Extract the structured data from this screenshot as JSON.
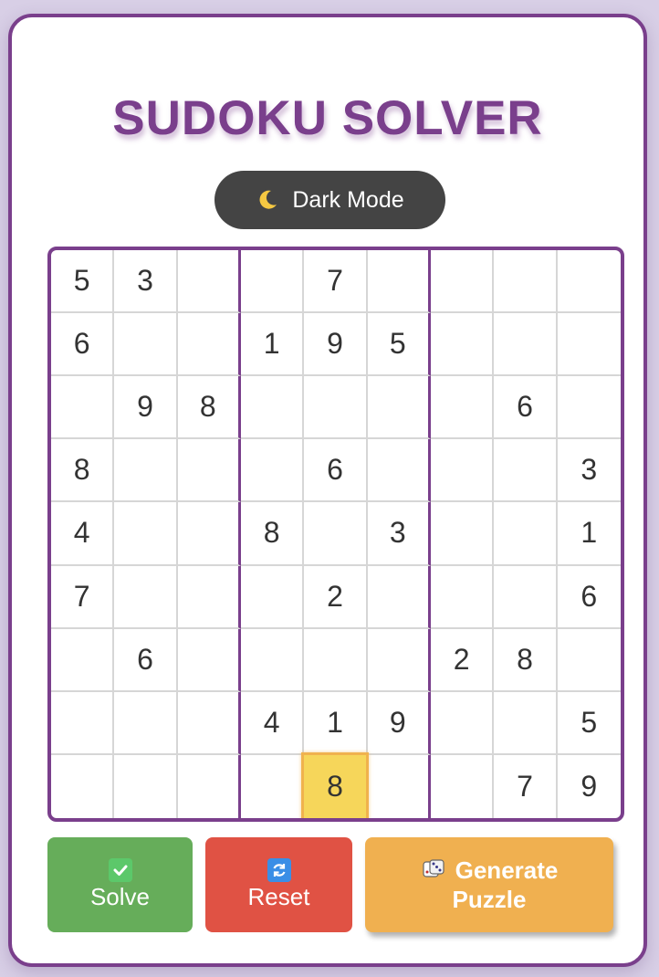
{
  "app": {
    "title": "SUDOKU SOLVER",
    "dark_mode_label": "Dark Mode",
    "dark_mode_icon": "moon-icon"
  },
  "grid": [
    [
      "5",
      "3",
      "",
      "",
      "7",
      "",
      "",
      "",
      ""
    ],
    [
      "6",
      "",
      "",
      "1",
      "9",
      "5",
      "",
      "",
      ""
    ],
    [
      "",
      "9",
      "8",
      "",
      "",
      "",
      "",
      "6",
      ""
    ],
    [
      "8",
      "",
      "",
      "",
      "6",
      "",
      "",
      "",
      "3"
    ],
    [
      "4",
      "",
      "",
      "8",
      "",
      "3",
      "",
      "",
      "1"
    ],
    [
      "7",
      "",
      "",
      "",
      "2",
      "",
      "",
      "",
      "6"
    ],
    [
      "",
      "6",
      "",
      "",
      "",
      "",
      "2",
      "8",
      ""
    ],
    [
      "",
      "",
      "",
      "4",
      "1",
      "9",
      "",
      "",
      "5"
    ],
    [
      "",
      "",
      "",
      "",
      "8",
      "",
      "",
      "7",
      "9"
    ]
  ],
  "highlighted_cell": {
    "row": 8,
    "col": 4
  },
  "buttons": {
    "solve_label": "Solve",
    "solve_icon": "check-icon",
    "reset_label": "Reset",
    "reset_icon": "refresh-icon",
    "generate_line1": "Generate",
    "generate_line2": "Puzzle",
    "generate_icon": "dice-icon"
  },
  "colors": {
    "accent": "#7a3f8c",
    "solve": "#66ad5a",
    "reset": "#e05244",
    "generate": "#f0b050",
    "highlight": "#f6d65a"
  }
}
